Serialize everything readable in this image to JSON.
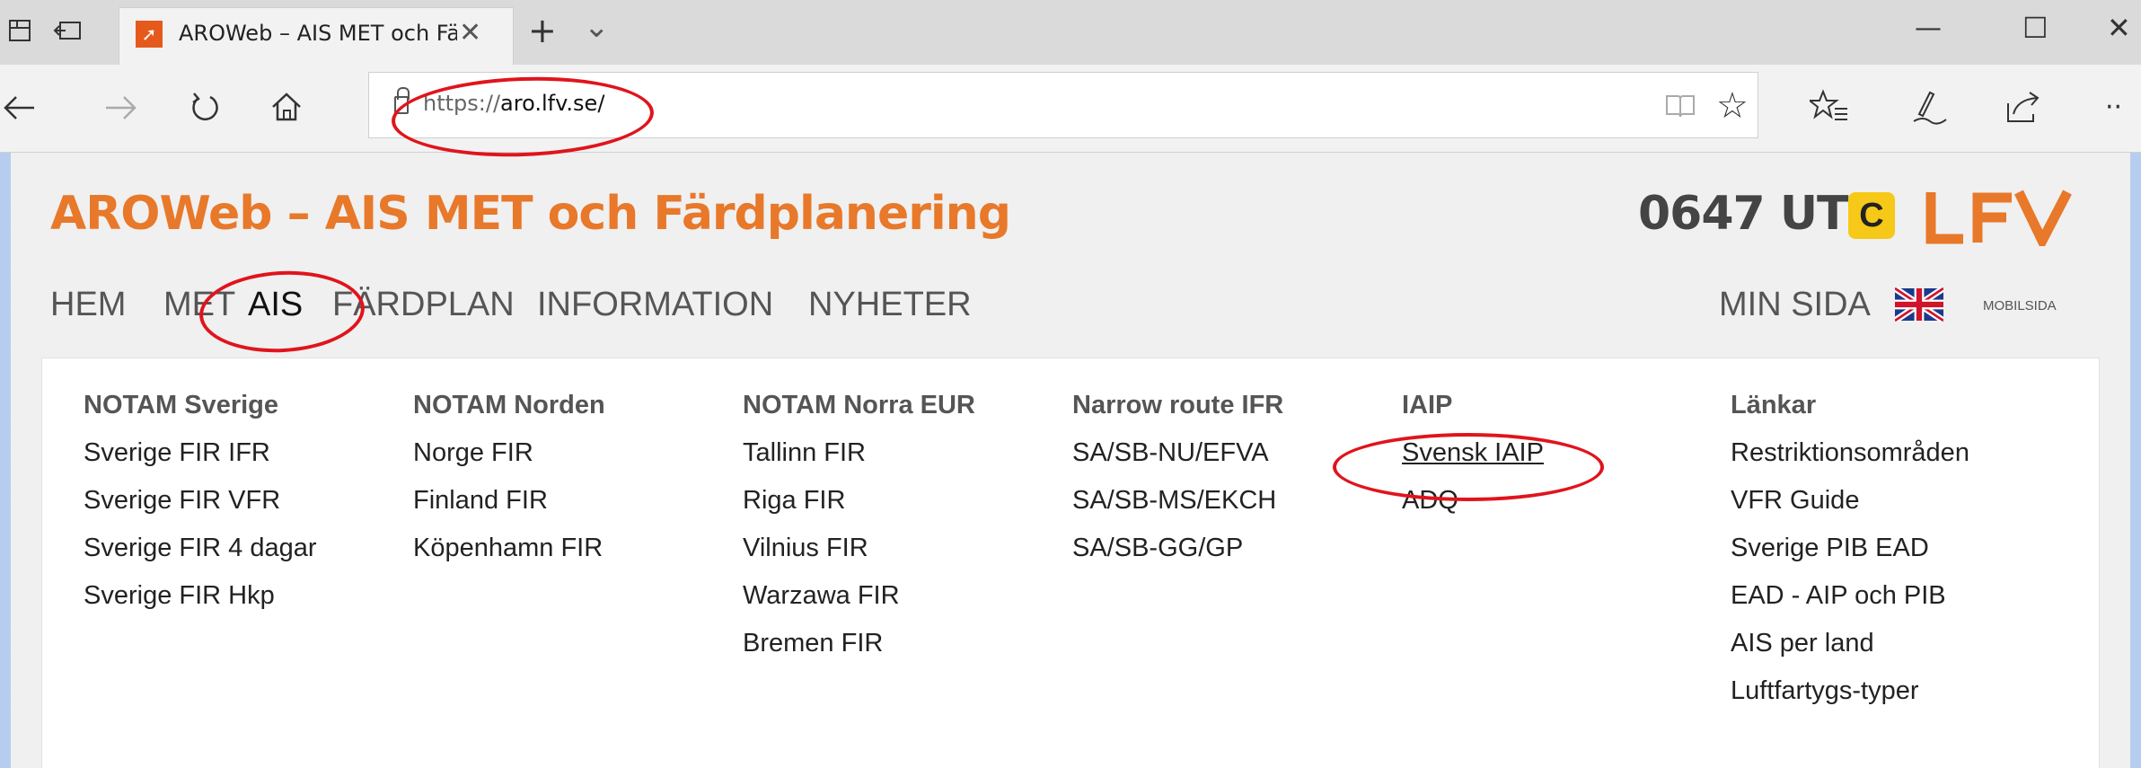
{
  "browser": {
    "tab_title": "AROWeb – AIS MET och Färdplanering",
    "tab_close": "✕",
    "new_tab": "+",
    "tab_list": "⌄",
    "url_prefix": "https://",
    "url_host": "aro.lfv.se/",
    "window_minimize": "—",
    "window_maximize": "☐",
    "window_close": "✕",
    "icons": [
      "tab-preview-icon",
      "tab-aside-icon",
      "back-icon",
      "forward-icon",
      "refresh-icon",
      "home-icon",
      "reading-view-icon",
      "favorite-star-icon",
      "favorites-hub-icon",
      "pen-icon",
      "share-icon",
      "more-icon"
    ]
  },
  "header": {
    "site_title": "AROWeb – AIS MET och Färdplanering",
    "clock": "0647 UTC",
    "badge": "C",
    "logo": "LFV"
  },
  "nav": {
    "items": [
      "HEM",
      "MET",
      "AIS",
      "FÄRDPLAN",
      "INFORMATION",
      "NYHETER"
    ],
    "active": "AIS",
    "min_sida": "MIN SIDA",
    "mobilsida": "MOBILSIDA"
  },
  "menu": {
    "columns": [
      {
        "header": "NOTAM Sverige",
        "links": [
          "Sverige FIR IFR",
          "Sverige FIR VFR",
          "Sverige FIR 4 dagar",
          "Sverige FIR Hkp"
        ]
      },
      {
        "header": "NOTAM Norden",
        "links": [
          "Norge FIR",
          "Finland FIR",
          "Köpenhamn FIR"
        ]
      },
      {
        "header": "NOTAM Norra EUR",
        "links": [
          "Tallinn FIR",
          "Riga FIR",
          "Vilnius FIR",
          "Warzawa FIR",
          "Bremen FIR"
        ]
      },
      {
        "header": "Narrow route IFR",
        "links": [
          "SA/SB-NU/EFVA",
          "SA/SB-MS/EKCH",
          "SA/SB-GG/GP"
        ]
      },
      {
        "header": "IAIP",
        "links": [
          "Svensk IAIP",
          "ADQ"
        ]
      },
      {
        "header": "Länkar",
        "links": [
          "Restriktionsområden",
          "VFR Guide",
          "Sverige PIB EAD",
          "EAD - AIP och PIB",
          "AIS per land",
          "Luftfartygs-typer"
        ]
      }
    ]
  },
  "colors": {
    "brand_orange": "#e8782a",
    "annotation_red": "#e0141c",
    "badge_yellow": "#f6c818"
  }
}
